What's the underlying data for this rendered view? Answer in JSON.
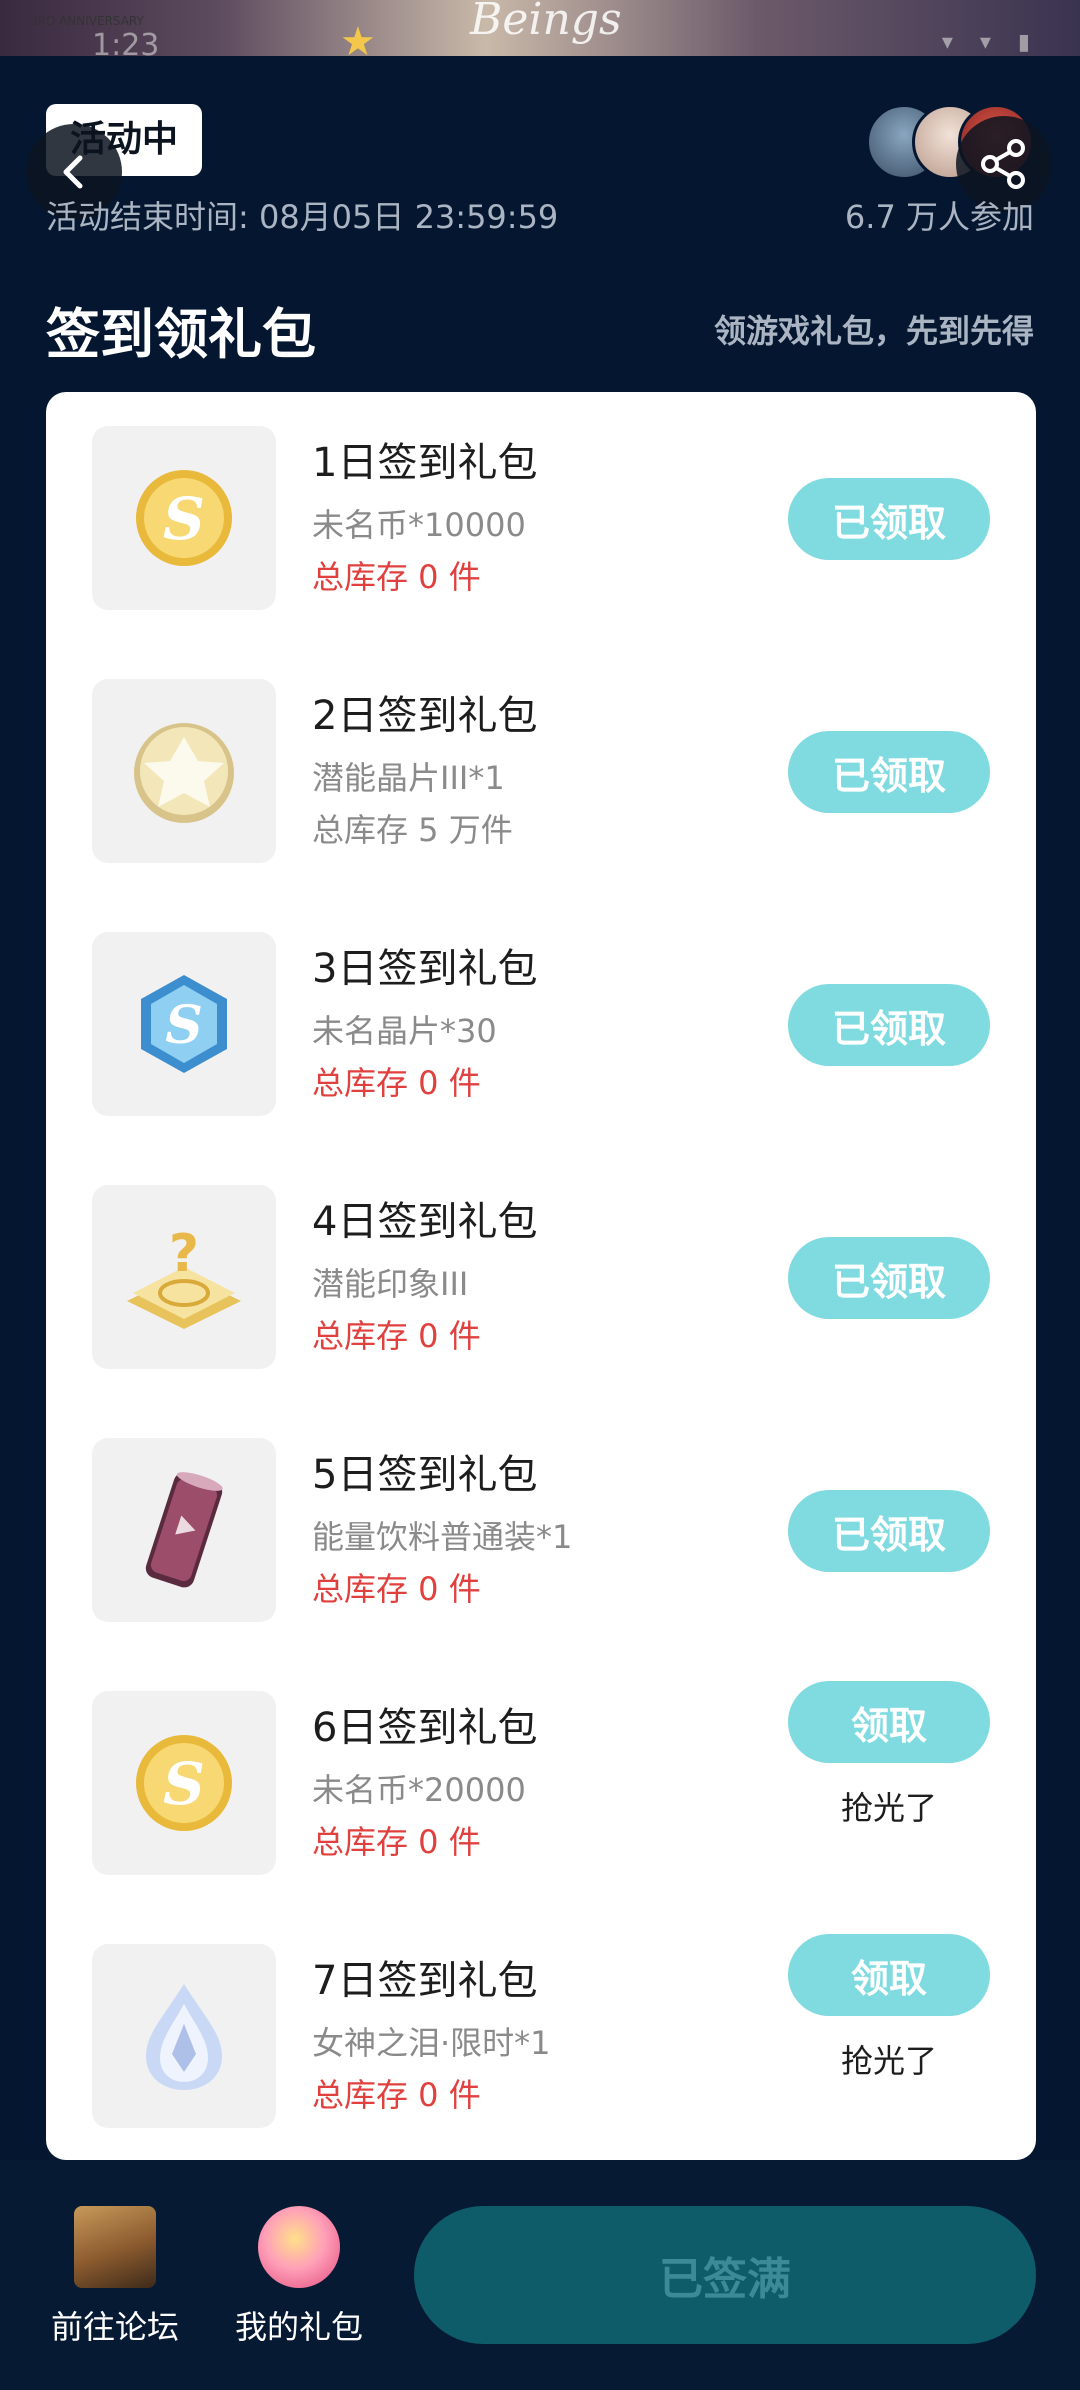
{
  "status_bar": {
    "time": "1:23",
    "anniversary_text": "3RD ANNIVERSARY",
    "banner_script": "Beings"
  },
  "header": {
    "status_label": "活动中",
    "end_time": "活动结束时间: 08月05日 23:59:59",
    "participants": "6.7 万人参加"
  },
  "section": {
    "title": "签到领礼包",
    "subtitle": "领游戏礼包，先到先得"
  },
  "gifts": [
    {
      "title": "1日签到礼包",
      "desc": "未名币*10000",
      "stock": "总库存 0 件",
      "stock_color": "#e0403e",
      "button": "已领取",
      "status": "",
      "icon": "gold-coin-icon"
    },
    {
      "title": "2日签到礼包",
      "desc": "潜能晶片III*1",
      "stock": "总库存 5 万件",
      "stock_color": "#8a8a8a",
      "button": "已领取",
      "status": "",
      "icon": "potential-chip-icon"
    },
    {
      "title": "3日签到礼包",
      "desc": "未名晶片*30",
      "stock": "总库存 0 件",
      "stock_color": "#e0403e",
      "button": "已领取",
      "status": "",
      "icon": "blue-crystal-icon"
    },
    {
      "title": "4日签到礼包",
      "desc": "潜能印象III",
      "stock": "总库存 0 件",
      "stock_color": "#e0403e",
      "button": "已领取",
      "status": "",
      "icon": "mystery-impression-icon"
    },
    {
      "title": "5日签到礼包",
      "desc": "能量饮料普通装*1",
      "stock": "总库存 0 件",
      "stock_color": "#e0403e",
      "button": "已领取",
      "status": "",
      "icon": "energy-drink-icon"
    },
    {
      "title": "6日签到礼包",
      "desc": "未名币*20000",
      "stock": "总库存 0 件",
      "stock_color": "#e0403e",
      "button": "领取",
      "status": "抢光了",
      "icon": "gold-coin-icon"
    },
    {
      "title": "7日签到礼包",
      "desc": "女神之泪·限时*1",
      "stock": "总库存 0 件",
      "stock_color": "#e0403e",
      "button": "领取",
      "status": "抢光了",
      "icon": "goddess-tear-icon"
    }
  ],
  "bottom": {
    "forum_label": "前往论坛",
    "mygifts_label": "我的礼包",
    "signed_label": "已签满"
  },
  "colors": {
    "background": "#051730",
    "button": "#7fdbe0",
    "stock_red": "#e0403e",
    "signed_button": "#0e5c6a"
  }
}
